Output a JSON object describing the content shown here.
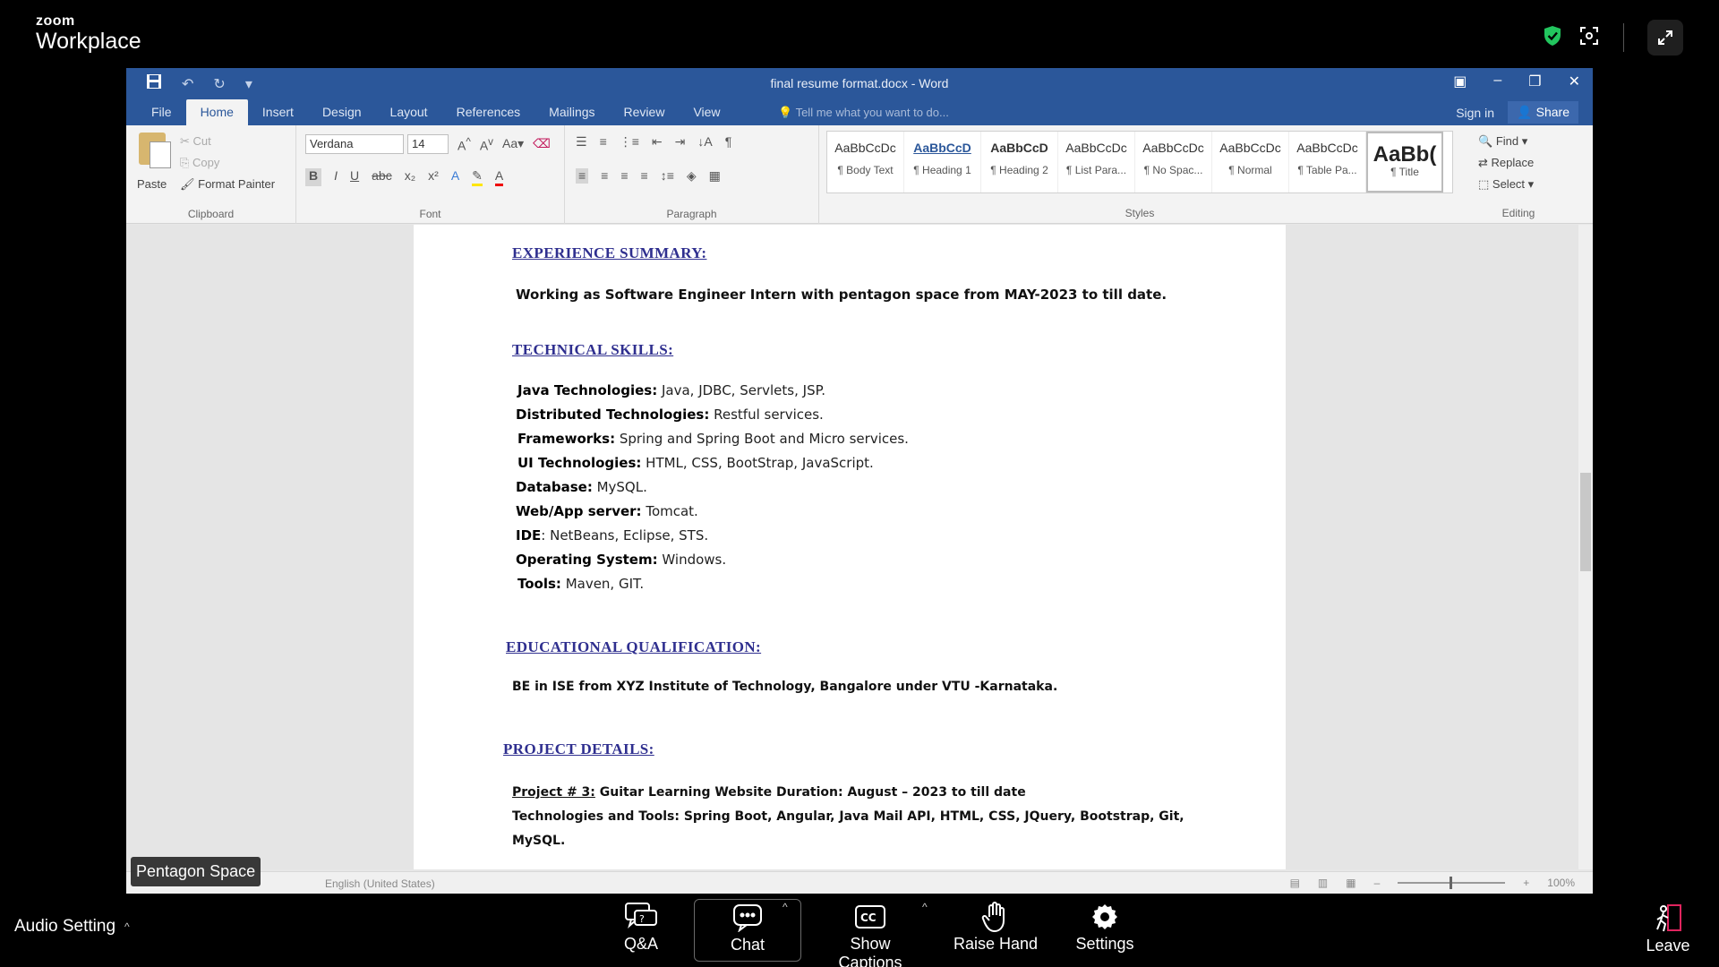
{
  "zoom": {
    "brand_small": "zoom",
    "brand_big": "Workplace",
    "name_tag": "Pentagon Space",
    "bottom": {
      "audio_label": "Audio Setting",
      "qa": "Q&A",
      "chat": "Chat",
      "captions": "Show Captions",
      "raise_hand": "Raise Hand",
      "settings": "Settings",
      "leave": "Leave"
    },
    "colors": {
      "shield": "#22c55e",
      "leave": "#e0245e"
    }
  },
  "word": {
    "title": "final resume format.docx - Word",
    "tabs": [
      "File",
      "Home",
      "Insert",
      "Design",
      "Layout",
      "References",
      "Mailings",
      "Review",
      "View"
    ],
    "tell_me": "Tell me what you want to do...",
    "sign_in": "Sign in",
    "share": "Share",
    "ribbon": {
      "paste": "Paste",
      "cut": "Cut",
      "copy": "Copy",
      "format_painter": "Format Painter",
      "clipboard": "Clipboard",
      "font_name": "Verdana",
      "font_size": "14",
      "font_group": "Font",
      "paragraph_group": "Paragraph",
      "styles_group": "Styles",
      "editing_group": "Editing",
      "find": "Find",
      "replace": "Replace",
      "select": "Select",
      "styles": [
        {
          "sample": "AaBbCcDc",
          "name": "¶ Body Text"
        },
        {
          "sample": "AaBbCcD",
          "name": "¶ Heading 1"
        },
        {
          "sample": "AaBbCcD",
          "name": "¶ Heading 2"
        },
        {
          "sample": "AaBbCcDc",
          "name": "¶ List Para..."
        },
        {
          "sample": "AaBbCcDc",
          "name": "¶ No Spac..."
        },
        {
          "sample": "AaBbCcDc",
          "name": "¶ Normal"
        },
        {
          "sample": "AaBbCcDc",
          "name": "¶ Table Pa..."
        },
        {
          "sample": "AaBb(",
          "name": "¶ Title"
        }
      ]
    },
    "status": {
      "language": "English (United States)",
      "zoom": "100%"
    },
    "document": {
      "experience_heading": "EXPERIENCE SUMMARY:",
      "experience_text": "Working as Software Engineer Intern with pentagon space from MAY-2023 to till date.",
      "skills_heading": "TECHNICAL SKILLS:",
      "skills": [
        {
          "label": "Java Technologies:",
          "value": " Java, JDBC, Servlets, JSP."
        },
        {
          "label": "Distributed Technologies:",
          "value": " Restful services."
        },
        {
          "label": "Frameworks:",
          "value": " Spring and Spring Boot and Micro services."
        },
        {
          "label": "UI Technologies:",
          "value": " HTML, CSS, BootStrap, JavaScript."
        },
        {
          "label": "Database:",
          "value": " MySQL."
        },
        {
          "label": "Web/App server:",
          "value": " Tomcat."
        },
        {
          "label": "IDE",
          "value": ": NetBeans, Eclipse, STS."
        },
        {
          "label": "Operating System:",
          "value": " Windows."
        },
        {
          "label": "Tools:",
          "value": " Maven, GIT."
        }
      ],
      "education_heading": "EDUCATIONAL QUALIFICATION:",
      "education_text": "BE in ISE from XYZ Institute of Technology, Bangalore under VTU -Karnataka.",
      "project_heading": "PROJECT DETAILS:",
      "project_label": "Project # 3:",
      "project_title": " Guitar Learning Website Duration: August – 2023 to till date",
      "project_tech": "Technologies and Tools: Spring Boot, Angular, Java Mail API, HTML, CSS, JQuery, Bootstrap, Git,",
      "project_tech_2": "MySQL."
    }
  }
}
